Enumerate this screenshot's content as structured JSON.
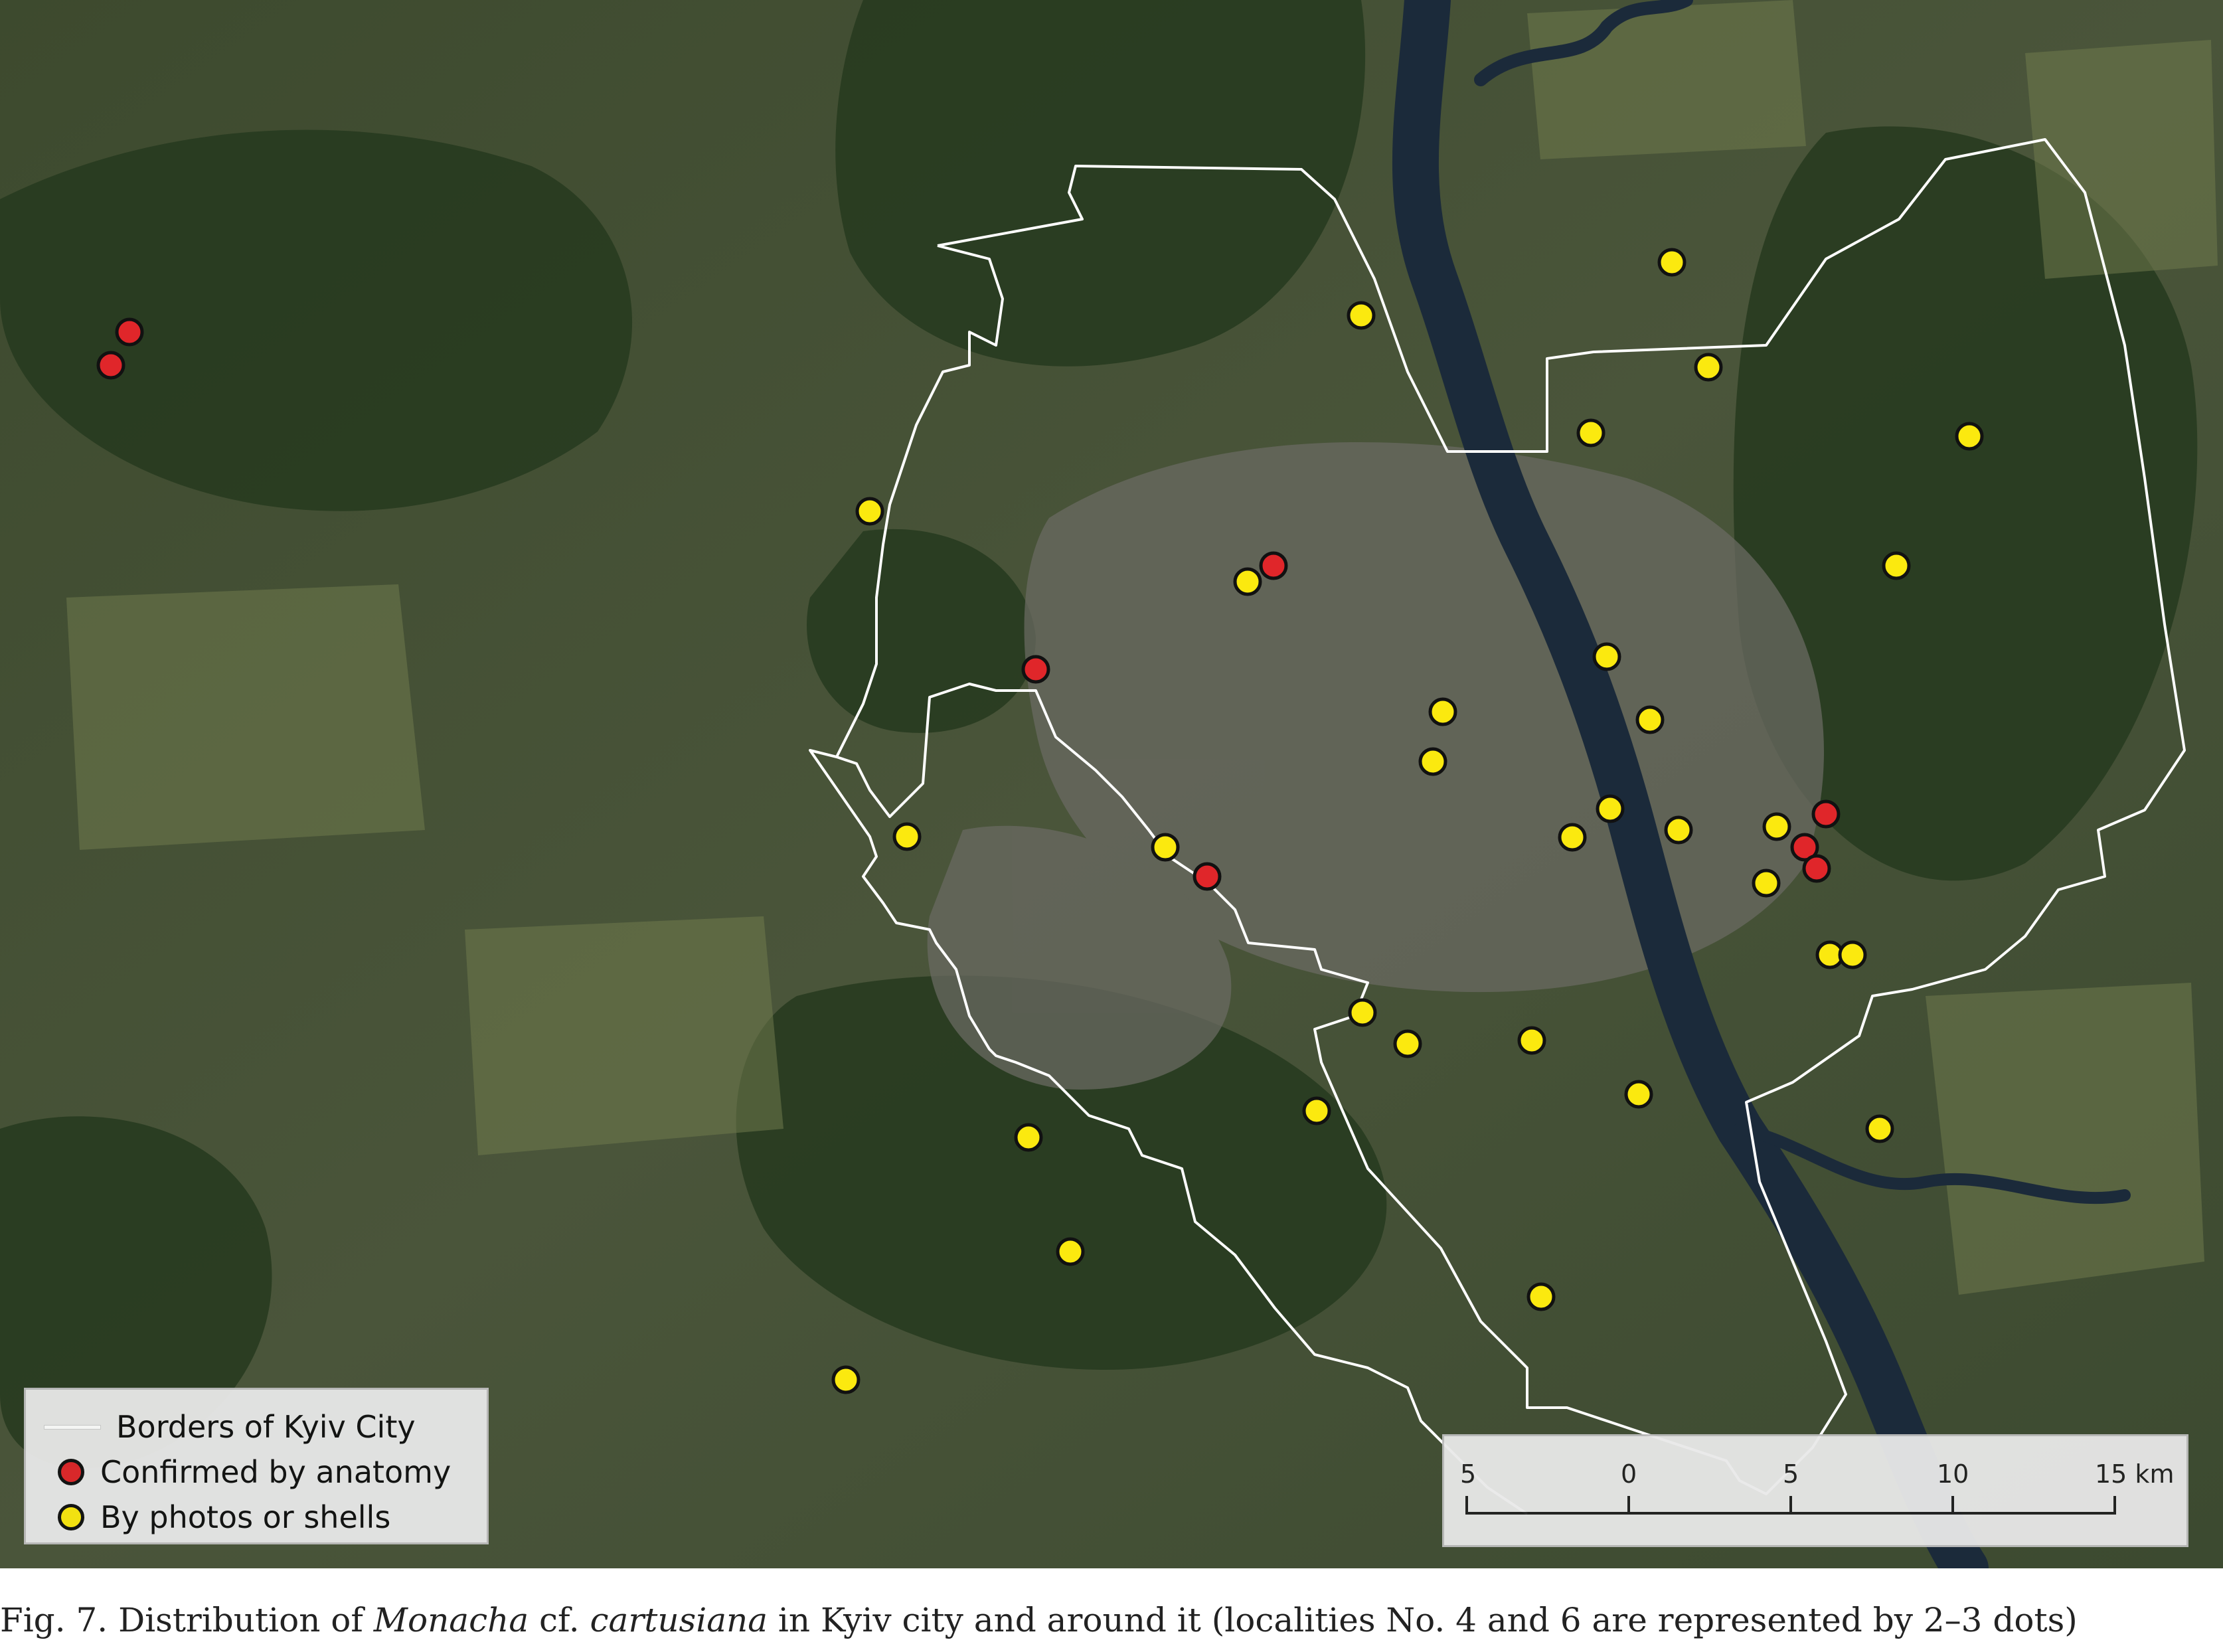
{
  "legend": {
    "border_label": "Borders of Kyiv City",
    "anatomy_label": "Confirmed by anatomy",
    "photo_label": "By photos or shells"
  },
  "scale": {
    "labels": [
      "5",
      "0",
      "5",
      "10",
      "15 km"
    ]
  },
  "caption": {
    "prefix": "Fig. 7. Distribution of ",
    "genus": "Monacha",
    "mid": " cf. ",
    "species": "cartusiana",
    "suffix": " in Kyiv city and around it (localities No. 4 and 6 are represented by 2–3 dots)"
  },
  "colors": {
    "anatomy": "#e0262a",
    "photos": "#fbe90f",
    "border": "#ffffff"
  }
}
